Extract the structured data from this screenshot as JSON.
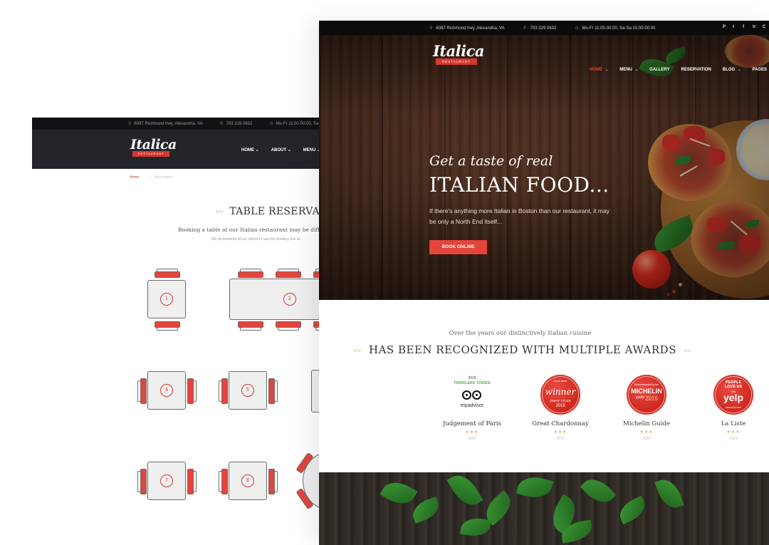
{
  "reservation_page": {
    "topbar": {
      "address": "6087 Richmond hwy, Alexandria, VA",
      "phone": "703 329 0632",
      "hours": "Mo-Fr 11:00-00:00, Sa"
    },
    "logo": {
      "name": "Italica",
      "ribbon": "RESTAURANT"
    },
    "menu": [
      "HOME",
      "ABOUT",
      "MENU"
    ],
    "breadcrumb": {
      "home": "Home",
      "current": "Reservation"
    },
    "title": "TABLE RESERVAT",
    "lead": "Booking a table at our Italian restaurant may be difficu",
    "note": "We recommend all our clients to use this booking tool as",
    "tables": [
      "1",
      "2",
      "4",
      "5",
      "7",
      "8"
    ]
  },
  "home_page": {
    "topbar": {
      "address": "6087 Richmond hwy, Alexandria, VA",
      "phone": "703 329 0632",
      "hours": "Mo-Fr 11:00-00:00, Sa-Sa 15:00-00:00",
      "social": [
        "P",
        "t",
        "f",
        "tr",
        "C"
      ]
    },
    "logo": {
      "name": "Italica",
      "ribbon": "RESTAURANT"
    },
    "menu": [
      {
        "label": "HOME",
        "active": true,
        "dropdown": true
      },
      {
        "label": "MENU",
        "active": false,
        "dropdown": true
      },
      {
        "label": "GALLERY",
        "active": false,
        "dropdown": false
      },
      {
        "label": "RESERVATION",
        "active": false,
        "dropdown": false
      },
      {
        "label": "BLOG",
        "active": false,
        "dropdown": true
      },
      {
        "label": "PAGES",
        "active": false,
        "dropdown": false
      }
    ],
    "hero": {
      "script": "Get a taste of real",
      "title": "ITALIAN FOOD...",
      "text": "If there's anything more Italian in Boston than our restaurant, it may be only a North End itself...",
      "button": "BOOK ONLINE"
    },
    "awards": {
      "subtitle": "Over the years our distinctively Italian cuisine",
      "title": "HAS BEEN RECOGNIZED WITH MULTIPLE AWARDS",
      "items": [
        {
          "badge_top": "2015",
          "badge_main": "TRAVELERS' CHOICE",
          "badge_brand": "tripadvisor",
          "name": "Judgement of Paris",
          "stars": "★★★",
          "year": "2014"
        },
        {
          "badge_top": "OpenTable",
          "badge_main": "winner",
          "badge_sub": "Diners' Choice",
          "badge_year": "2015",
          "name": "Great Chardonnay",
          "stars": "★★★",
          "year": "2014"
        },
        {
          "badge_top": "Recommended by the",
          "badge_main": "MICHELIN",
          "badge_sub": "guide",
          "badge_year": "2015",
          "name": "Michelin Guide",
          "stars": "★★★",
          "year": "2014"
        },
        {
          "badge_top": "PEOPLE LOVE US",
          "badge_sub": "ON",
          "badge_main": "yelp",
          "badge_footer": "www.yelp.com",
          "name": "La Liste",
          "stars": "★★★",
          "year": "2014"
        }
      ]
    }
  },
  "colors": {
    "accent": "#e5443b",
    "dark": "#23252b",
    "gold": "#c9a37a"
  }
}
